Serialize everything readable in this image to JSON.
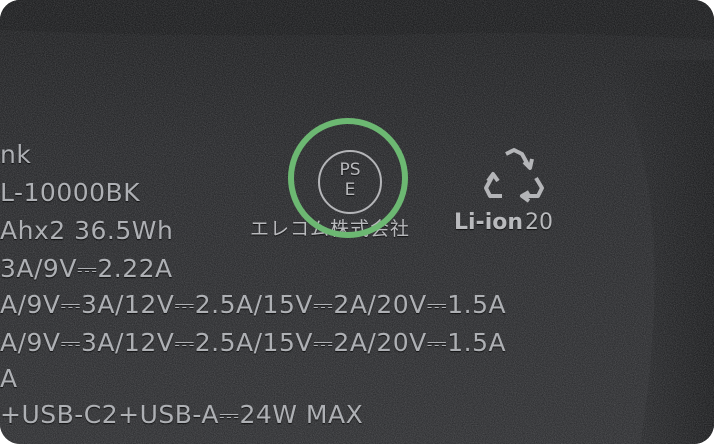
{
  "label_lines": [
    "nk",
    "L-10000BK",
    "Ahx2 36.5Wh",
    "3A/9V⎓2.22A",
    "A/9V⎓3A/12V⎓2.5A/15V⎓2A/20V⎓1.5A",
    "A/9V⎓3A/12V⎓2.5A/15V⎓2A/20V⎓1.5A",
    "A",
    "+USB-C2+USB-A⎓24W MAX"
  ],
  "pse_mark": {
    "top": "PS",
    "bottom": "E"
  },
  "manufacturer": "エレコム株式会社",
  "battery_type": {
    "text": "Li-ion",
    "number": "20"
  },
  "recycle_icon": "recycle-arrows-icon",
  "highlight_color": "#6cb872",
  "surface_color": "#1f2022"
}
